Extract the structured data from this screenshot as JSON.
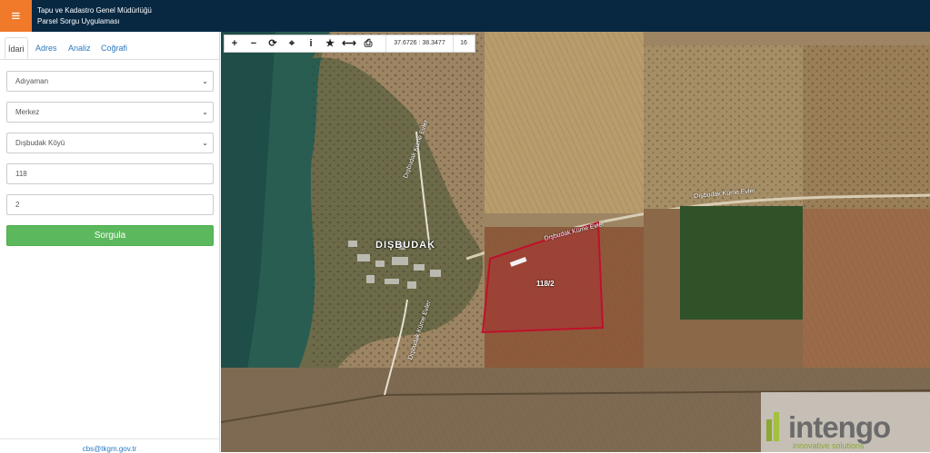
{
  "header": {
    "menu_icon": "hamburger-icon",
    "title_line1": "Tapu ve Kadastro Genel Müdürlüğü",
    "title_line2": "Parsel Sorgu Uygulaması"
  },
  "sidebar": {
    "tabs": [
      {
        "label": "İdari",
        "active": true
      },
      {
        "label": "Adres",
        "active": false
      },
      {
        "label": "Analiz",
        "active": false
      },
      {
        "label": "Coğrafi",
        "active": false
      }
    ],
    "province": "Adıyaman",
    "district": "Merkez",
    "neighborhood": "Dışbudak Köyü",
    "block_no": "118",
    "parcel_no": "2",
    "query_label": "Sorgula",
    "footer_email": "cbs@tkgm.gov.tr"
  },
  "toolbar": {
    "tools": [
      "zoom-in-icon",
      "zoom-out-icon",
      "refresh-icon",
      "locate-icon",
      "info-icon",
      "star-icon",
      "measure-icon",
      "print-icon"
    ],
    "coordinates": "37.6726 : 38.3477",
    "zoom_level": "16"
  },
  "map": {
    "place_label": "DIŞBUDAK",
    "road_label_1": "Dışbudak Küme Evler",
    "road_label_2": "Dışbudak Küme Evler",
    "road_label_3": "Dışbudak Küme Evler",
    "road_label_4": "Dışbudak Küme Evler",
    "parcel_label": "118/2",
    "parcel_color": "#c0102a",
    "logo_text": "intengo",
    "logo_subtitle": "innovative solutions"
  }
}
